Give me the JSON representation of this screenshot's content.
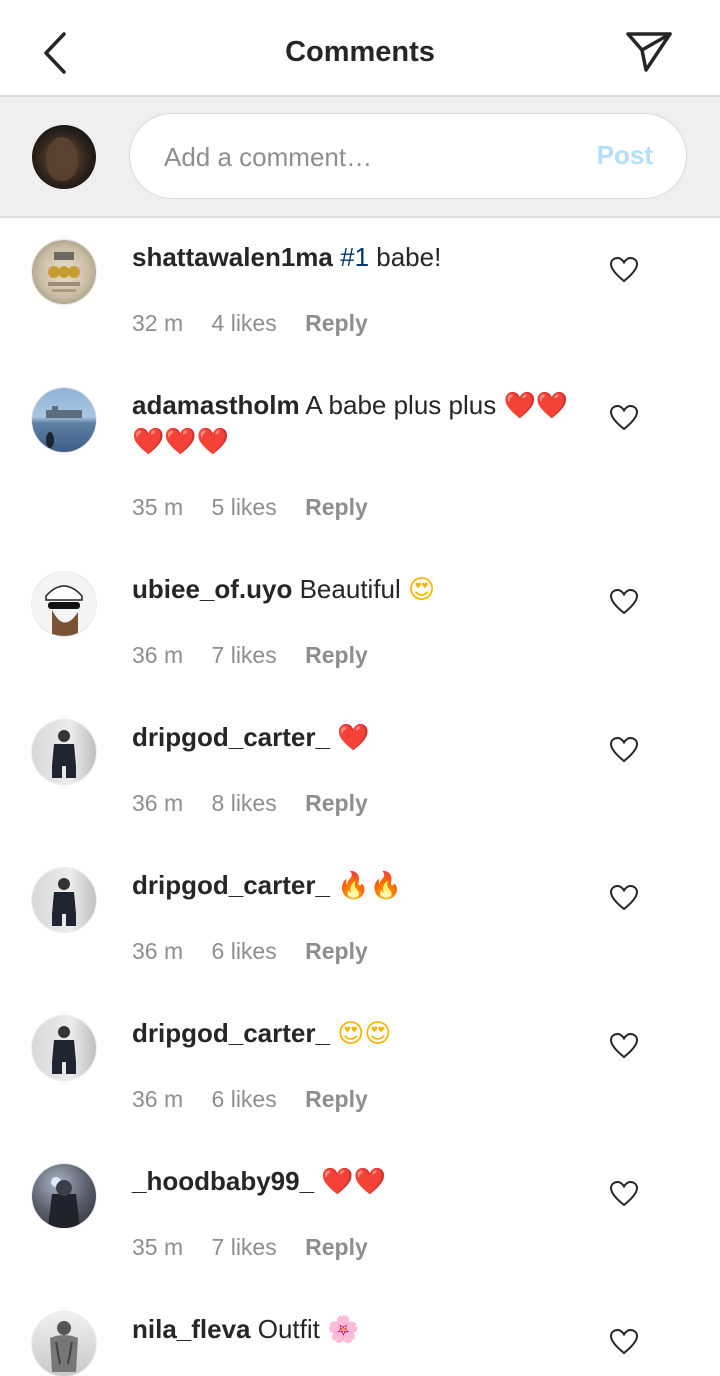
{
  "header": {
    "title": "Comments",
    "back_icon": "chevron-left-icon",
    "send_icon": "paper-plane-icon"
  },
  "composer": {
    "placeholder": "Add a comment…",
    "post_label": "Post",
    "post_color": "#b2dffc"
  },
  "colors": {
    "text": "#262626",
    "muted": "#8e8e8e",
    "hashtag": "#00376b",
    "divider": "#dbdbdb",
    "composer_bg": "#efefef"
  },
  "comments": [
    {
      "username": "shattawalen1ma",
      "hashtag": "#1",
      "text": "babe!",
      "emoji": "",
      "time": "32 m",
      "likes": "4 likes",
      "reply": "Reply"
    },
    {
      "username": "adamastholm",
      "text": "A babe plus plus",
      "emoji": "❤️❤️❤️❤️❤️",
      "time": "35 m",
      "likes": "5 likes",
      "reply": "Reply"
    },
    {
      "username": "ubiee_of.uyo",
      "text": "Beautiful",
      "emoji": "😍",
      "time": "36 m",
      "likes": "7 likes",
      "reply": "Reply"
    },
    {
      "username": "dripgod_carter_",
      "text": "",
      "emoji": "❤️",
      "time": "36 m",
      "likes": "8 likes",
      "reply": "Reply"
    },
    {
      "username": "dripgod_carter_",
      "text": "",
      "emoji": "🔥🔥",
      "time": "36 m",
      "likes": "6 likes",
      "reply": "Reply"
    },
    {
      "username": "dripgod_carter_",
      "text": "",
      "emoji": "😍😍",
      "time": "36 m",
      "likes": "6 likes",
      "reply": "Reply"
    },
    {
      "username": "_hoodbaby99_",
      "text": "",
      "emoji": "❤️❤️",
      "time": "35 m",
      "likes": "7 likes",
      "reply": "Reply"
    },
    {
      "username": "nila_fleva",
      "text": "Outfit",
      "emoji": "🌸"
    }
  ]
}
